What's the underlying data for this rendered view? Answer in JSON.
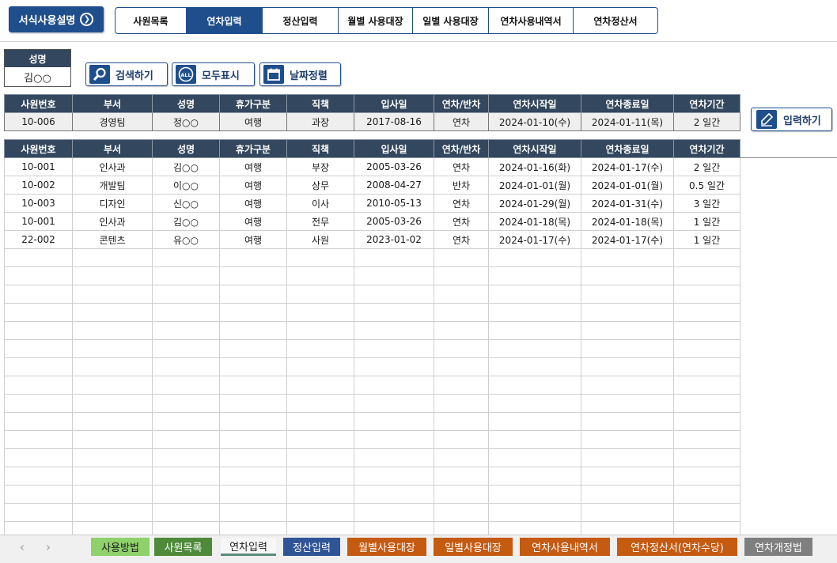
{
  "header": {
    "help_label": "서식사용설명",
    "nav_tabs": [
      {
        "label": "사원목록"
      },
      {
        "label": "연차입력"
      },
      {
        "label": "정산입력"
      },
      {
        "label": "월별 사용대장"
      },
      {
        "label": "일별 사용대장"
      },
      {
        "label": "연차사용내역서"
      },
      {
        "label": "연차정산서"
      }
    ]
  },
  "name_box": {
    "label": "성명",
    "value": "김○○"
  },
  "toolbar": {
    "search_label": "검색하기",
    "show_all_label": "모두표시",
    "sort_label": "날짜정렬",
    "input_label": "입력하기",
    "all_icon_text": "ALL"
  },
  "columns": [
    "사원번호",
    "부서",
    "성명",
    "휴가구분",
    "직책",
    "입사일",
    "연차/반차",
    "연차시작일",
    "연차종료일",
    "연차기간"
  ],
  "entry_row": [
    "10-006",
    "경영팀",
    "정○○",
    "여행",
    "과장",
    "2017-08-16",
    "연차",
    "2024-01-10(수)",
    "2024-01-11(목)",
    "2 일간"
  ],
  "records": [
    [
      "10-001",
      "인사과",
      "김○○",
      "여행",
      "부장",
      "2005-03-26",
      "연차",
      "2024-01-16(화)",
      "2024-01-17(수)",
      "2 일간"
    ],
    [
      "10-002",
      "개발팀",
      "이○○",
      "여행",
      "상무",
      "2008-04-27",
      "반차",
      "2024-01-01(월)",
      "2024-01-01(월)",
      "0.5 일간"
    ],
    [
      "10-003",
      "디자인",
      "신○○",
      "여행",
      "이사",
      "2010-05-13",
      "연차",
      "2024-01-29(월)",
      "2024-01-31(수)",
      "3 일간"
    ],
    [
      "10-001",
      "인사과",
      "김○○",
      "여행",
      "전무",
      "2005-03-26",
      "연차",
      "2024-01-18(목)",
      "2024-01-18(목)",
      "1 일간"
    ],
    [
      "22-002",
      "콘텐츠",
      "유○○",
      "여행",
      "사원",
      "2023-01-02",
      "연차",
      "2024-01-17(수)",
      "2024-01-17(수)",
      "1 일간"
    ]
  ],
  "sheet_tabs": [
    {
      "label": "사용방법",
      "color": "#8fd16b",
      "text_color": "#1a1a1a"
    },
    {
      "label": "사원목록",
      "color": "#4f8a3a",
      "text_color": "#ffffff"
    },
    {
      "label": "연차입력",
      "color": "#f7f7f7",
      "text_color": "#222222"
    },
    {
      "label": "정산입력",
      "color": "#2f5597",
      "text_color": "#ffffff"
    },
    {
      "label": "월별사용대장",
      "color": "#c55a11",
      "text_color": "#ffffff"
    },
    {
      "label": "일별사용대장",
      "color": "#c55a11",
      "text_color": "#ffffff"
    },
    {
      "label": "연차사용내역서",
      "color": "#c55a11",
      "text_color": "#ffffff"
    },
    {
      "label": "연차정산서(연차수당)",
      "color": "#c55a11",
      "text_color": "#ffffff"
    },
    {
      "label": "연차개정법",
      "color": "#7f7f7f",
      "text_color": "#ffffff"
    }
  ],
  "colors": {
    "header_bg": "#33475e",
    "accent": "#1f4e8c"
  }
}
